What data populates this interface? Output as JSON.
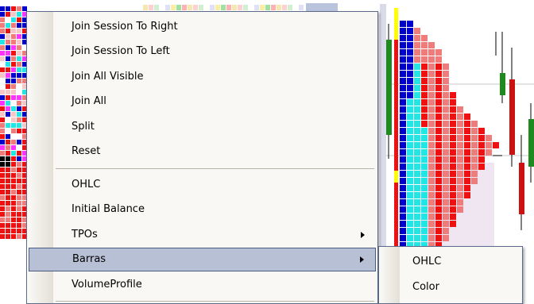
{
  "context_menu": {
    "items": [
      {
        "label": "Join Session To Right"
      },
      {
        "label": "Join Session To Left"
      },
      {
        "label": "Join All Visible"
      },
      {
        "label": "Join All"
      },
      {
        "label": "Split"
      },
      {
        "label": "Reset"
      },
      {
        "label": "OHLC"
      },
      {
        "label": "Initial Balance"
      },
      {
        "label": "TPOs",
        "has_submenu": true
      },
      {
        "label": "Barras",
        "has_submenu": true,
        "highlighted": true
      },
      {
        "label": "VolumeProfile"
      }
    ]
  },
  "submenu": {
    "items": [
      {
        "label": "OHLC"
      },
      {
        "label": "Color"
      }
    ]
  },
  "colors": {
    "menu_background": "#f9f8f4",
    "menu_border": "#5a6b8c",
    "highlight": "#b8c0d5",
    "tpo_blue": "#0000cc",
    "tpo_cyan": "#22e6e6",
    "tpo_red": "#ee1111",
    "tpo_pink": "#f07b7b",
    "candle_green": "#1f8a1f",
    "candle_red": "#cc1111",
    "value_area": "#efe6f2"
  }
}
